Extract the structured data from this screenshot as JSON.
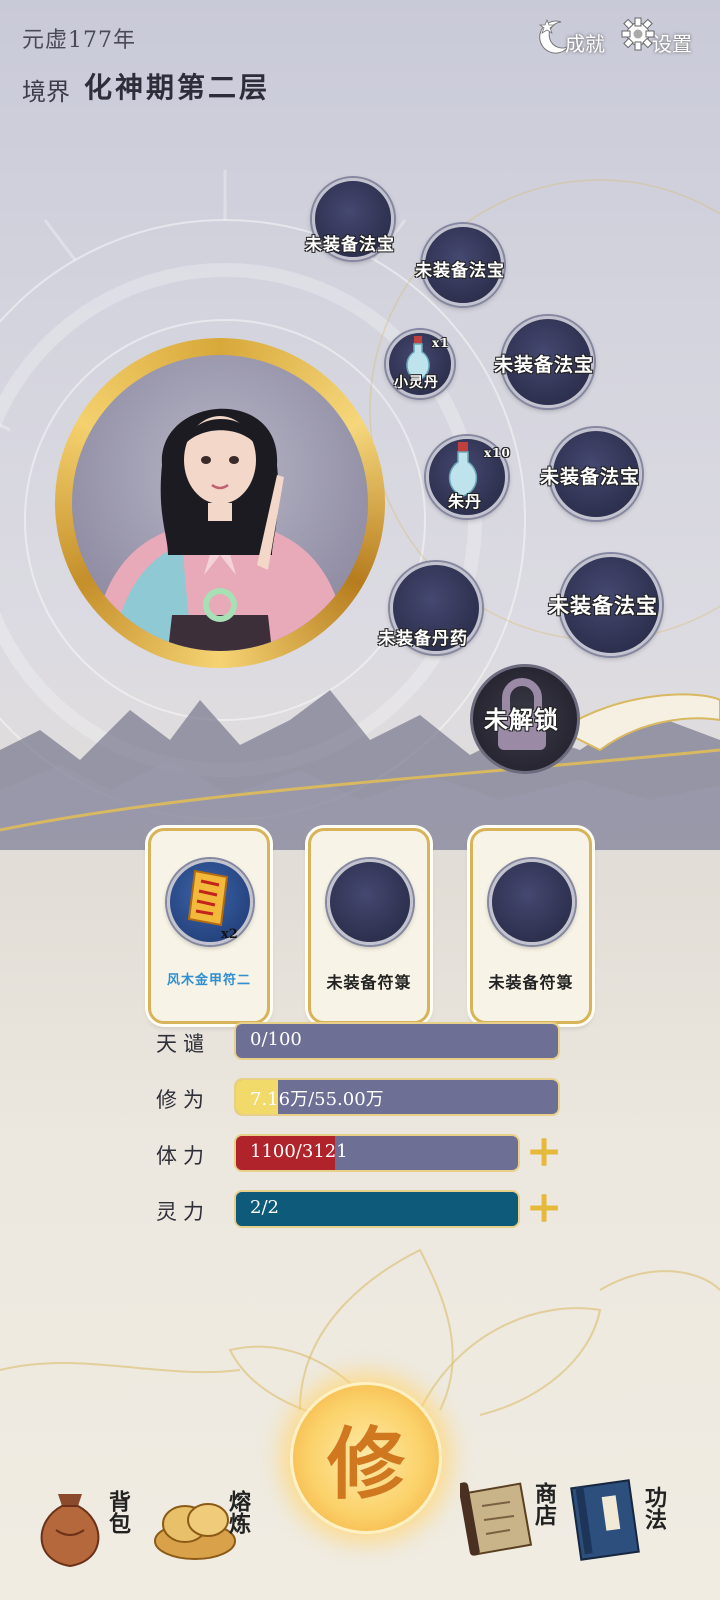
{
  "header": {
    "era": "元虚177年",
    "realm_label": "境界",
    "realm_value": "化神期第二层"
  },
  "top_buttons": {
    "achievements": "成就",
    "settings": "设置"
  },
  "slots": {
    "artifact_1": "未装备法宝",
    "artifact_2": "未装备法宝",
    "artifact_3": "未装备法宝",
    "artifact_4": "未装备法宝",
    "artifact_5": "未装备法宝",
    "pill_small": "小灵丹",
    "pill_small_count": "x1",
    "pill_zhu": "朱丹",
    "pill_zhu_count": "x10",
    "medicine": "未装备丹药",
    "locked": "未解锁"
  },
  "talismans": [
    {
      "label": "风木金甲符二",
      "count": "x2"
    },
    {
      "label": "未装备符箓"
    },
    {
      "label": "未装备符箓"
    }
  ],
  "stats": {
    "tianqian": {
      "label": "天谴",
      "text": "0/100",
      "fraction": 0.0
    },
    "xiuwei": {
      "label": "修为",
      "text": "7.16万/55.00万",
      "fraction": 0.13
    },
    "tili": {
      "label": "体力",
      "text": "1100/3121",
      "fraction": 0.35
    },
    "lingli": {
      "label": "灵力",
      "text": "2/2",
      "fraction": 1.0
    }
  },
  "colors": {
    "xiuwei_fill": "#f2da6a",
    "tili_fill": "#b1232a",
    "lingli_fill": "#0e5a7a",
    "bar_bg": "#6e6f95",
    "gold": "#d8a83a"
  },
  "nav": {
    "bag": "背包",
    "forge": "熔炼",
    "cultivate": "修",
    "shop": "商店",
    "skills": "功法"
  }
}
